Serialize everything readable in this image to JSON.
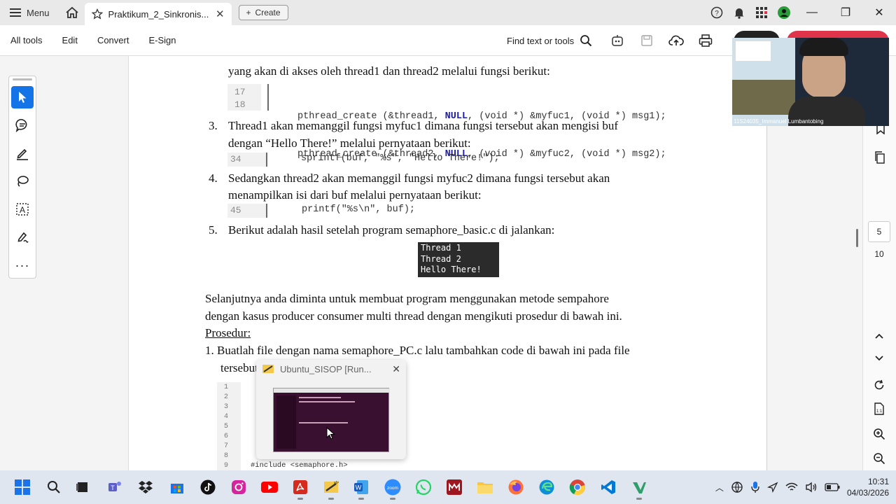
{
  "tabbar": {
    "menu_label": "Menu",
    "tab_title": "Praktikum_2_Sinkronis...",
    "create_label": "Create"
  },
  "toolbar": {
    "items": [
      "All tools",
      "Edit",
      "Convert",
      "E-Sign"
    ],
    "find_label": "Find text or tools"
  },
  "document": {
    "item2_line1": "yang akan di akses oleh thread1 dan thread2 melalui fungsi berikut:",
    "code_lines": [
      {
        "num": "17",
        "pre": "pthread_create (&thread1, ",
        "mid": ", (void *) &myfuc1, (void *) msg1);"
      },
      {
        "num": "18",
        "pre": "pthread_create (&thread2, ",
        "mid": ", (void *) &myfuc2, (void *) msg2);"
      }
    ],
    "null_kw": "NULL",
    "item3_num": "3.",
    "item3_line1": "Thread1 akan memanggil fungsi myfuc1 dimana fungsi tersebut akan mengisi buf",
    "item3_line2": "dengan “Hello There!” melalui pernyataan berikut:",
    "code34_num": "34",
    "code34": "sprintf(buf, \"%s\", \"Hello There!\");",
    "item4_num": "4.",
    "item4_line1": "Sedangkan thread2 akan memanggil fungsi myfuc2 dimana fungsi tersebut akan",
    "item4_line2": "menampilkan isi dari buf melalui pernyataan berikut:",
    "code45_num": "45",
    "code45": "printf(\"%s\\n\", buf);",
    "item5_num": "5.",
    "item5_line1": "Berikut adalah hasil setelah program semaphore_basic.c di jalankan:",
    "terminal": [
      "Thread 1",
      "Thread 2",
      "Hello There!"
    ],
    "para_line1": "Selanjutnya anda diminta untuk membuat program menggunakan metode sempahore",
    "para_line2": "dengan kasus producer consumer multi thread dengan mengikuti prosedur di bawah ini.",
    "prosedur": "Prosedur:",
    "step1_line1": "1. Buatlah file dengan nama semaphore_PC.c lalu tambahkan code di bawah ini pada file",
    "step1_line2": "tersebut",
    "bottom_code_nums": [
      "1",
      "2",
      "3",
      "4",
      "5",
      "6",
      "7",
      "8",
      "9"
    ],
    "bottom_code_last": "#include <semaphore.h>"
  },
  "popup": {
    "title": "Ubuntu_SISOP [Run..."
  },
  "webcam": {
    "name": "11S24035_Immanuel Lumbantobing"
  },
  "pager": {
    "current": "5",
    "total": "10"
  },
  "clock": {
    "time": "10:31",
    "date": "04/03/2026"
  },
  "colors": {
    "accent": "#1473e6",
    "code_keyword": "#1e1ea8",
    "terminal_bg": "#2b2b2b"
  }
}
